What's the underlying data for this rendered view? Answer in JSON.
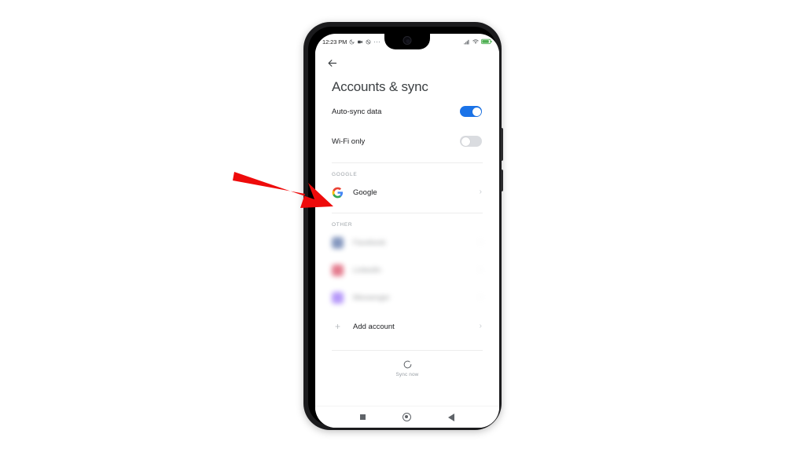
{
  "annotation": {
    "arrow_color": "#EE0B0B",
    "arrow_name": "red-pointer-arrow",
    "points_at": "Google"
  },
  "device": {
    "frame_color": "#1b1b1d",
    "notch_type": "waterdrop",
    "side_buttons": [
      "volume-rocker",
      "power-button"
    ]
  },
  "status_bar": {
    "time": "12:23 PM",
    "left_icons": [
      "moon-icon",
      "video-camera-icon",
      "no-sound-icon",
      "more-dots-icon"
    ],
    "right_icons": [
      "cellular-signal-icon",
      "wifi-icon",
      "battery-icon"
    ],
    "battery_color": "#4CAF50"
  },
  "app": {
    "back_button": "back-arrow-icon",
    "title": "Accounts & sync",
    "accent_color": "#1a73e8",
    "settings": [
      {
        "label": "Auto-sync data",
        "state": "on"
      },
      {
        "label": "Wi-Fi only",
        "state": "off"
      }
    ],
    "sections": [
      {
        "header": "GOOGLE",
        "accounts": [
          {
            "name": "Google",
            "icon": "google-g-icon",
            "redacted": false,
            "icon_color": "#4285F4"
          }
        ]
      },
      {
        "header": "OTHER",
        "accounts": [
          {
            "name": "Facebook",
            "icon": "facebook-icon",
            "redacted": true,
            "icon_color": "#3b5998"
          },
          {
            "name": "LinkedIn",
            "icon": "app-icon",
            "redacted": true,
            "icon_color": "#d42d4b"
          },
          {
            "name": "Messenger",
            "icon": "messenger-icon",
            "redacted": true,
            "icon_color": "#8b5cf6"
          }
        ]
      }
    ],
    "add_account": {
      "label": "Add account",
      "icon": "plus-icon"
    },
    "sync_footer": {
      "label": "Sync now",
      "icon": "refresh-circle-icon"
    }
  },
  "nav_bar": {
    "buttons": [
      {
        "name": "recents",
        "shape": "square"
      },
      {
        "name": "home",
        "shape": "circle"
      },
      {
        "name": "back",
        "shape": "triangle"
      }
    ]
  }
}
